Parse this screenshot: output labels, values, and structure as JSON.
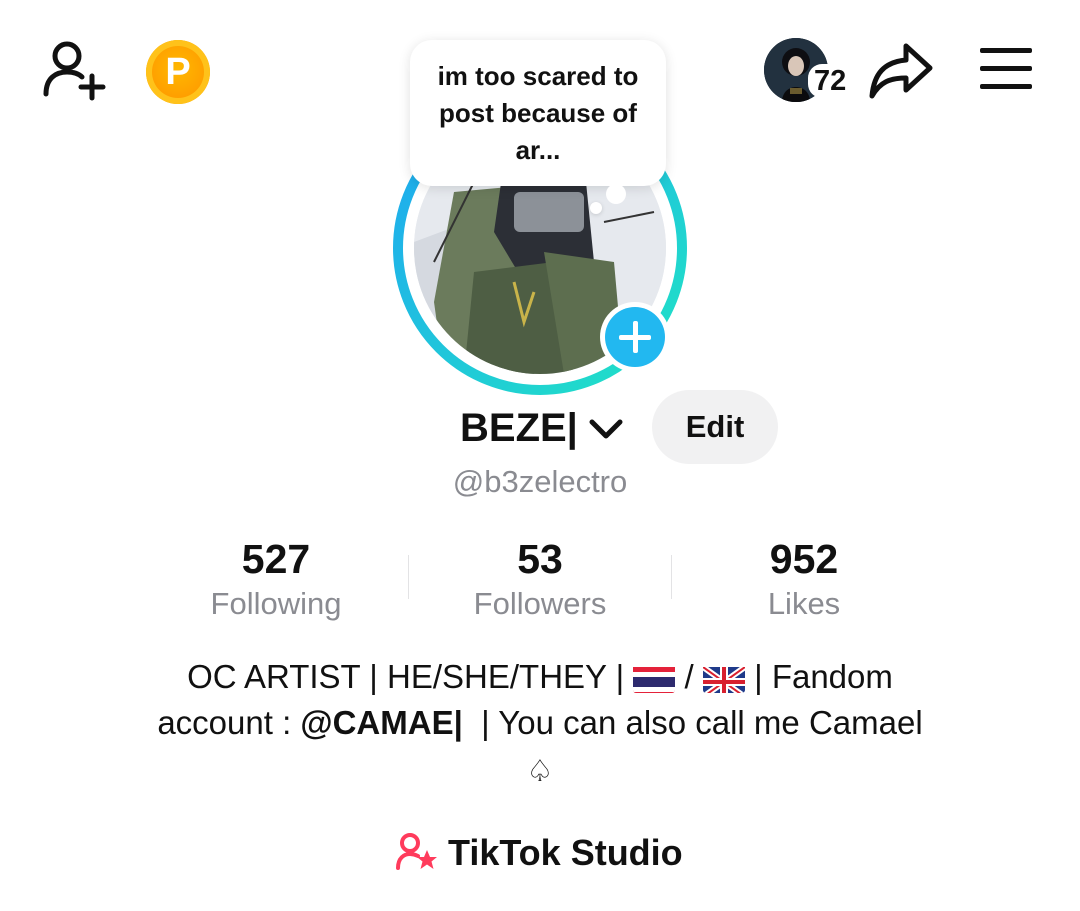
{
  "top_bar": {
    "add_friend_icon": "person-add-icon",
    "coin_icon": "coin-p-icon",
    "coin_letter": "P",
    "recent_viewer_count": "72",
    "share_icon": "share-arrow-icon",
    "menu_icon": "hamburger-menu-icon"
  },
  "note_bubble": {
    "text": "im too scared to post because of ar..."
  },
  "profile": {
    "display_name": "BEZE|",
    "edit_label": "Edit",
    "username": "@b3zelectro",
    "ring_colors": [
      "#1fb4f0",
      "#20e0c8"
    ],
    "add_button_color": "#22b8f0"
  },
  "stats": [
    {
      "value": "527",
      "label": "Following"
    },
    {
      "value": "53",
      "label": "Followers"
    },
    {
      "value": "952",
      "label": "Likes"
    }
  ],
  "bio": {
    "line1_a": "OC ARTIST | HE/SHE/THEY | ",
    "flag1": "thailand-flag",
    "line1_sep": " / ",
    "flag2": "uk-flag",
    "line1_b": " | Fandom",
    "line2_a": "account : ",
    "line2_bold": "@CAMAE|",
    "line2_b": "  | You can also call me Camael",
    "line3": "♤"
  },
  "studio": {
    "label": "TikTok Studio",
    "icon": "creator-star-icon",
    "icon_color": "#ff3b5c"
  }
}
